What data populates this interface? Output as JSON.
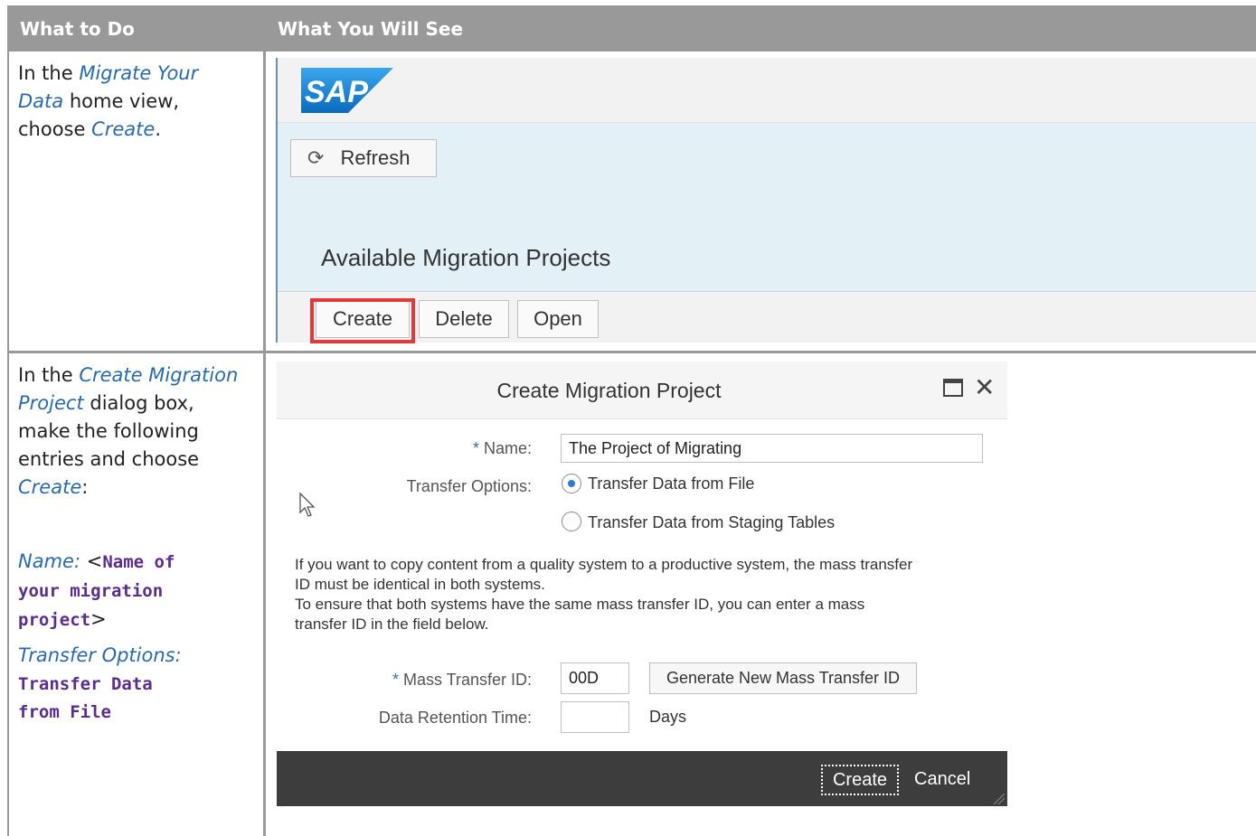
{
  "table": {
    "col1_header": "What to Do",
    "col2_header": "What You Will See"
  },
  "row1": {
    "t1": "In the ",
    "t2": "Migrate Your",
    "t3": "Data",
    "t4": " home view,",
    "t5": "choose ",
    "t6": "Create",
    "t7": "."
  },
  "row2": {
    "a1": "In the ",
    "a2": "Create Migration",
    "a3": "Project",
    "a4": " dialog box,",
    "a5": "make the following",
    "a6": "entries and choose",
    "a7": "Create",
    "a8": ":",
    "b1": "Name:",
    "b2": " <",
    "b3": "Name of",
    "b4": "your migration",
    "b5": "project",
    "b6": ">",
    "c1": "Transfer Options:",
    "c2": "Transfer Data",
    "c3": "from File"
  },
  "screen1": {
    "logo": "SAP",
    "refresh_label": "Refresh",
    "section_title": "Available Migration Projects",
    "create_label": "Create",
    "delete_label": "Delete",
    "open_label": "Open"
  },
  "dialog": {
    "title": "Create Migration Project",
    "name_label": "Name:",
    "name_value": "The Project of Migrating",
    "required_mark": "*",
    "transfer_label": "Transfer Options:",
    "option_file": "Transfer Data from File",
    "option_staging": "Transfer Data from Staging Tables",
    "info_line1": "If you want to copy content from a quality system to a productive system, the mass transfer",
    "info_line2": "ID must be identical in both systems.",
    "info_line3": "To ensure that both systems have the same mass transfer ID, you can enter a mass",
    "info_line4": "transfer ID in the field below.",
    "mass_id_label": "Mass Transfer ID:",
    "mass_id_value": "00D",
    "generate_label": "Generate New Mass Transfer ID",
    "retention_label": "Data Retention Time:",
    "retention_value": "",
    "days_label": "Days",
    "footer_create": "Create",
    "footer_cancel": "Cancel"
  },
  "colors": {
    "header_bg": "#999999",
    "link_blue": "#2a6aa8",
    "code_purple": "#5c2c8c",
    "highlight_red": "#e03a3a",
    "sap_blue": "#1a8ad8",
    "footer_dark": "#3d3d3d"
  },
  "icons": {
    "refresh": "refresh-icon",
    "maximize": "maximize-icon",
    "close": "close-icon",
    "cursor": "mouse-pointer-icon",
    "resize": "resize-grip-icon"
  }
}
